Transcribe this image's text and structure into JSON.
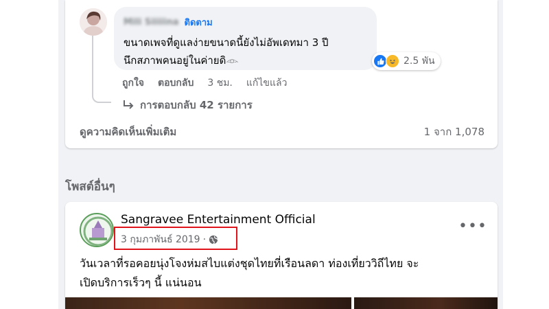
{
  "comment": {
    "author_name": "Mili Siiiiina",
    "follow_label": "ติดตาม",
    "text_line1": "ขนาดเพจที่ดูแลง่ายขนาดนี้ยังไม่อัพเดทมา 3 ปี",
    "text_line2": "นึกสภาพคนอยู่ในค่ายดิ𓁹",
    "reaction_count": "2.5 พัน",
    "like_label": "ถูกใจ",
    "reply_label": "ตอบกลับ",
    "time": "3 ชม.",
    "edited": "แก้ไขแล้ว",
    "replies_label": "การตอบกลับ 42 รายการ"
  },
  "comments_footer": {
    "more_label": "ดูความคิดเห็นเพิ่มเติม",
    "pagination": "1 จาก 1,078"
  },
  "section": {
    "title": "โพสต์อื่นๆ"
  },
  "post": {
    "page_name": "Sangravee Entertainment Official",
    "date": "3 กุมภาพันธ์ 2019",
    "separator": "·",
    "text_line1": "วันเวลาที่รอคอยนุ่งโจงห่มสไบแต่งชุดไทยที่เรือนลดา ท่องเที่ยววิถีไทย จะ",
    "text_line2": "เปิดบริการเร็วๆ นี้ แน่นอน",
    "more_icon": "•••"
  },
  "colors": {
    "link": "#1877f2",
    "secondary_text": "#65676b",
    "highlight_box": "#e0121a",
    "feed_background": "#f0f2f5"
  },
  "icons": [
    "reply-arrow-icon",
    "like-reaction-icon",
    "haha-reaction-icon",
    "globe-icon",
    "more-options-icon"
  ]
}
